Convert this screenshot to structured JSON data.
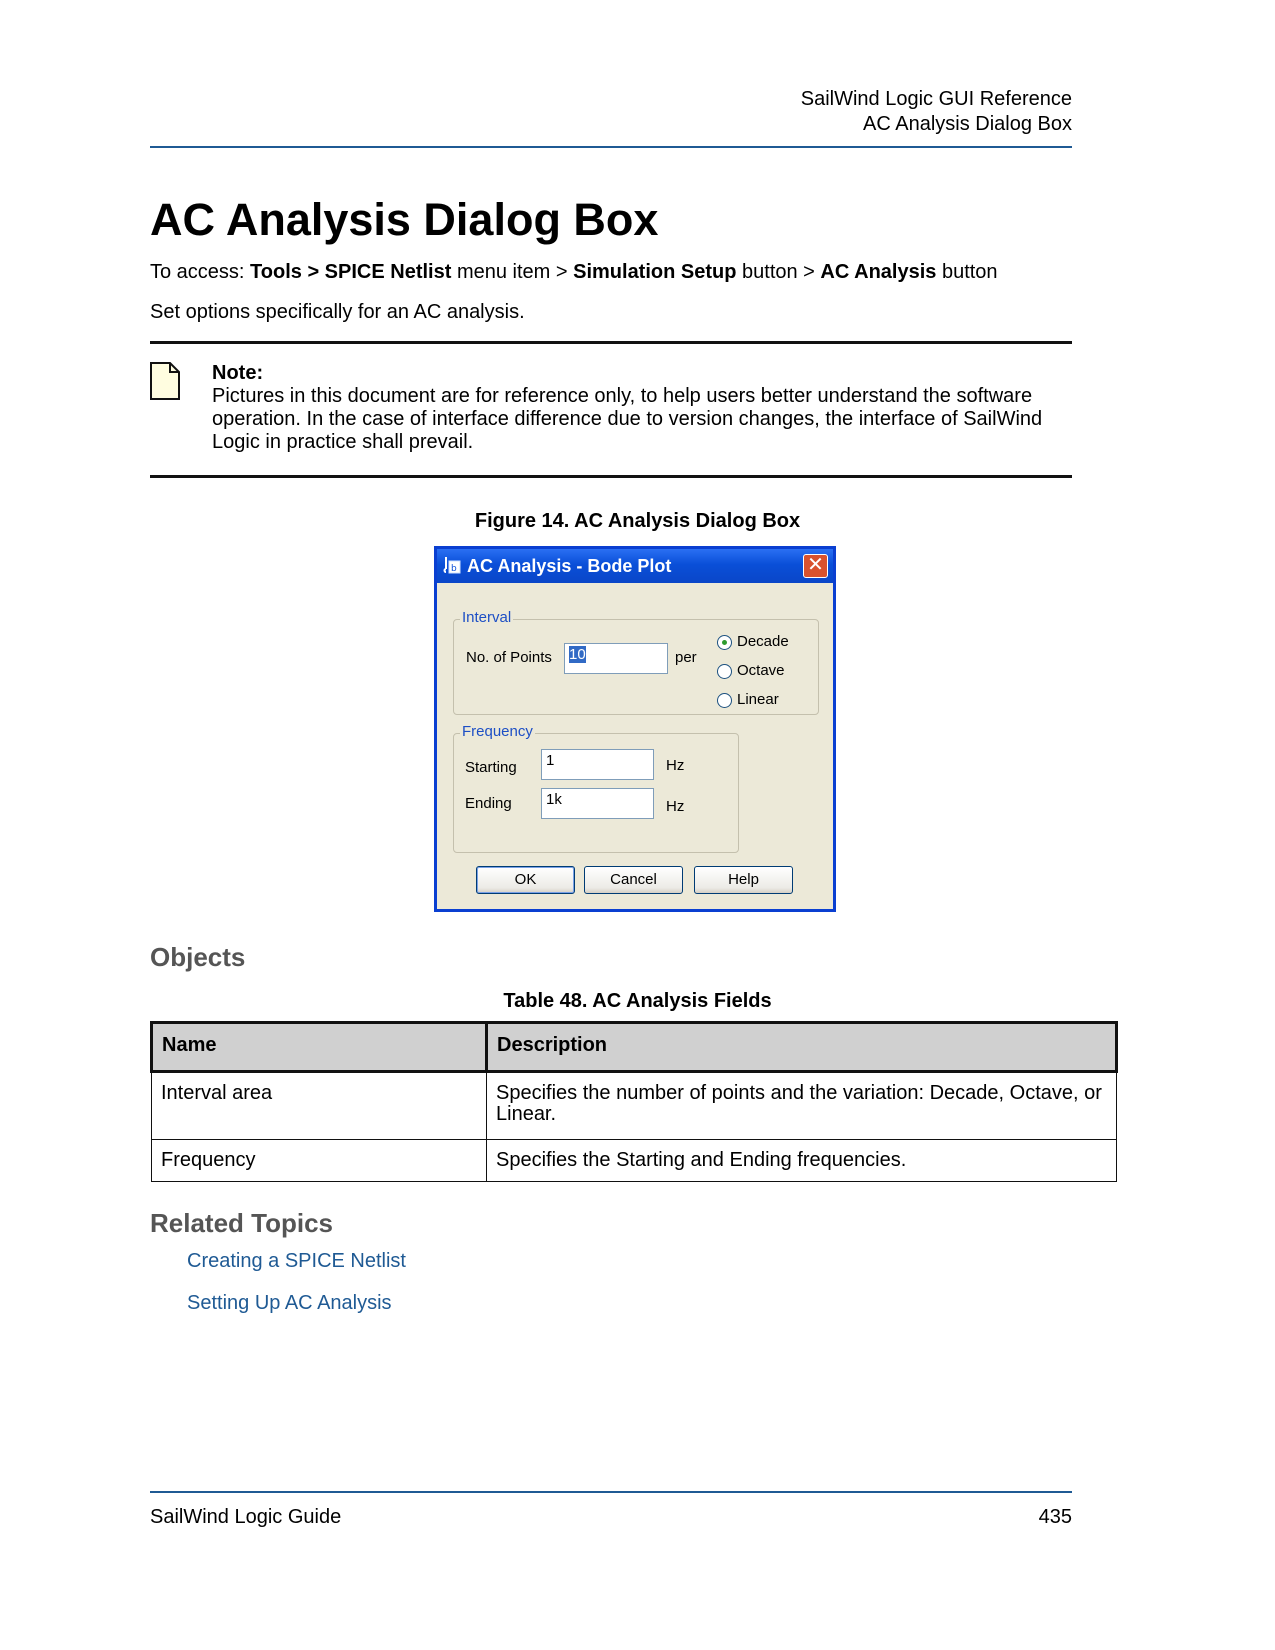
{
  "header": {
    "line1": "SailWind Logic GUI Reference",
    "line2": "AC Analysis Dialog Box"
  },
  "title": "AC Analysis Dialog Box",
  "access": {
    "prefix": "To access: ",
    "path1": "Tools > SPICE Netlist",
    "mid1": " menu item > ",
    "path2": "Simulation Setup",
    "mid2": " button > ",
    "path3": "AC Analysis",
    "suffix": " button"
  },
  "intro": "Set options specifically for an AC analysis.",
  "note": {
    "heading": "Note:",
    "text": "Pictures in this document are for reference only, to help users better understand the software operation. In the case of interface difference due to version changes, the interface of SailWind Logic in practice shall prevail."
  },
  "figure": {
    "caption": "Figure 14. AC Analysis Dialog Box",
    "dialog": {
      "title": "AC Analysis - Bode Plot",
      "close_label": "✕",
      "interval": {
        "label": "Interval",
        "points_label": "No. of Points",
        "points_value": "10",
        "per_label": "per",
        "options": [
          "Decade",
          "Octave",
          "Linear"
        ],
        "selected": "Decade"
      },
      "frequency": {
        "label": "Frequency",
        "starting_label": "Starting",
        "starting_value": "1",
        "starting_unit": "Hz",
        "ending_label": "Ending",
        "ending_value": "1k",
        "ending_unit": "Hz"
      },
      "buttons": {
        "ok": "OK",
        "cancel": "Cancel",
        "help": "Help"
      }
    }
  },
  "objects": {
    "heading": "Objects",
    "table_caption": "Table 48. AC Analysis Fields",
    "columns": [
      "Name",
      "Description"
    ],
    "rows": [
      {
        "name": "Interval area",
        "description": "Specifies the number of points and the variation: Decade, Octave, or Linear."
      },
      {
        "name": "Frequency",
        "description": "Specifies the Starting and Ending frequencies."
      }
    ]
  },
  "related": {
    "heading": "Related Topics",
    "links": [
      "Creating a SPICE Netlist",
      "Setting Up AC Analysis"
    ]
  },
  "footer": {
    "left": "SailWind Logic Guide",
    "page": "435"
  },
  "colors": {
    "rule_blue": "#1f5a94",
    "link_blue": "#1f5a94",
    "dialog_titlebar": "#0a4fd8",
    "dialog_face": "#ece9d8"
  }
}
